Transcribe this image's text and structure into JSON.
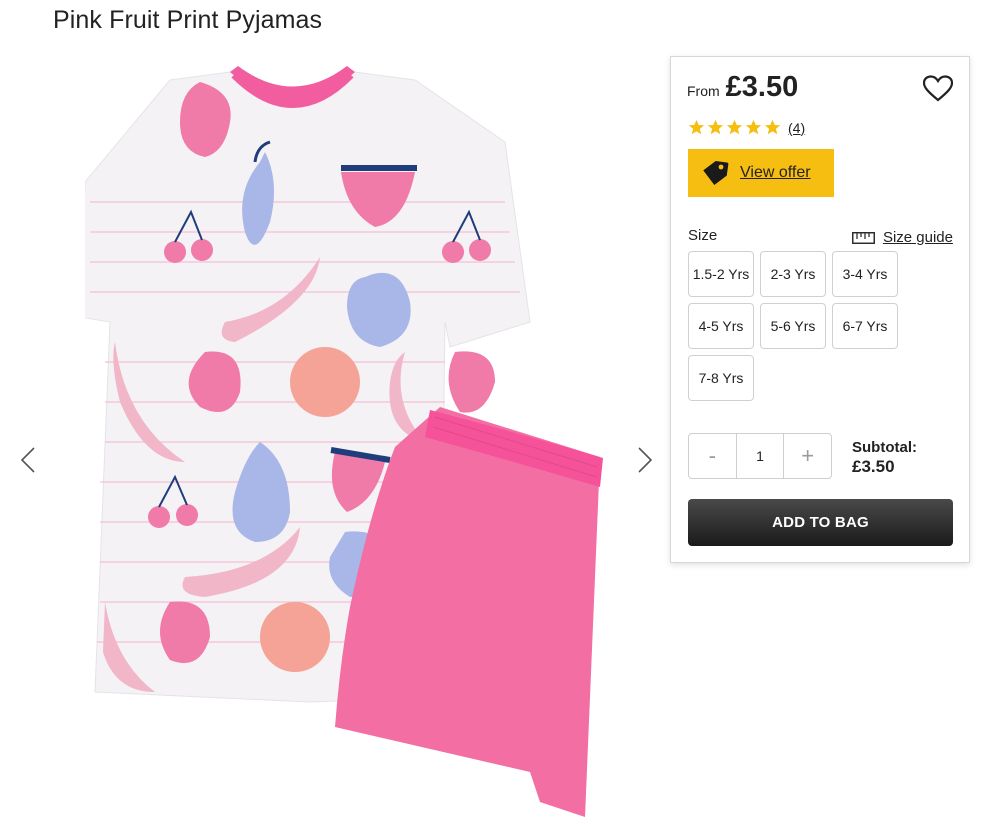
{
  "product": {
    "title": "Pink Fruit Print Pyjamas"
  },
  "gallery": {
    "prev_icon": "chevron-left-icon",
    "next_icon": "chevron-right-icon"
  },
  "buy_box": {
    "from_label": "From",
    "price": "£3.50",
    "wishlist_icon": "heart-icon",
    "rating": {
      "stars": 5,
      "max": 5,
      "count_label": "(4)",
      "star_color": "#f7be12"
    },
    "offer": {
      "label": "View offer",
      "icon": "tag-icon",
      "bg": "#f7be12"
    },
    "size": {
      "label": "Size",
      "guide_label": "Size guide",
      "guide_icon": "ruler-icon",
      "options": [
        "1.5-2 Yrs",
        "2-3 Yrs",
        "3-4 Yrs",
        "4-5 Yrs",
        "5-6 Yrs",
        "6-7 Yrs",
        "7-8 Yrs"
      ]
    },
    "quantity": {
      "minus": "-",
      "value": "1",
      "plus": "+"
    },
    "subtotal": {
      "label": "Subtotal:",
      "value": "£3.50"
    },
    "add_to_bag": "ADD TO BAG"
  },
  "colors": {
    "shorts_pink": "#f26ea3",
    "trim_pink": "#f25d9f",
    "dark_button": "#2a2a2a"
  }
}
